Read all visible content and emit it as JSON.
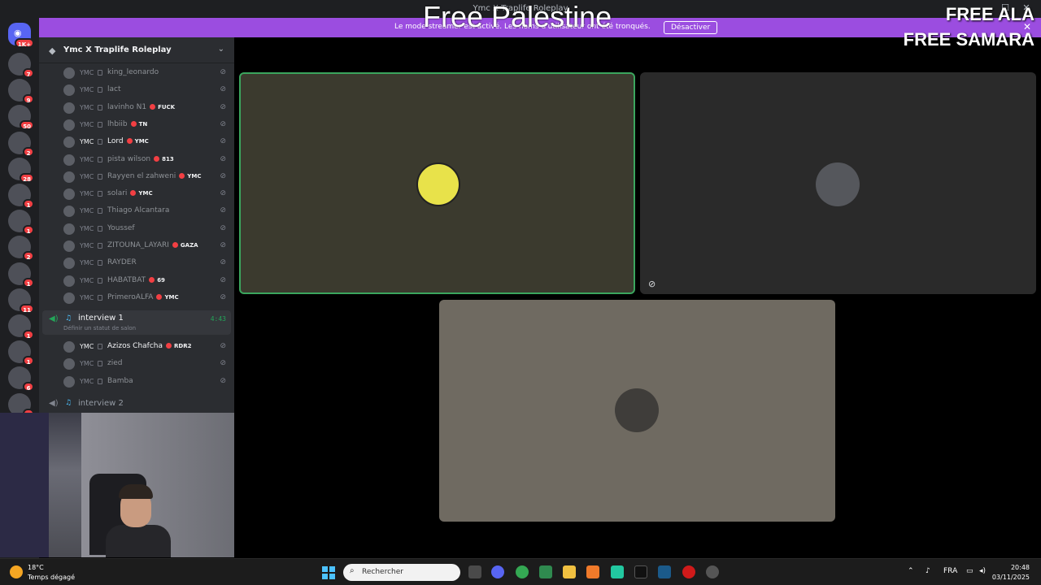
{
  "window": {
    "title": "Ymc X Traplife Roleplay"
  },
  "overlay": {
    "title": "Free Palestine",
    "free_lines": [
      "FREE ALA",
      "FREE SAMARA"
    ]
  },
  "banner": {
    "text": "Le mode streamer est activé. Les noms d'utilisateur ont été tronqués.",
    "button": "Désactiver"
  },
  "rail": {
    "home_badge": "1K+",
    "items": [
      {
        "badge": "7"
      },
      {
        "badge": "9"
      },
      {
        "badge": "50"
      },
      {
        "badge": "2"
      },
      {
        "badge": "28"
      },
      {
        "badge": "1"
      },
      {
        "badge": "1"
      },
      {
        "badge": "2"
      },
      {
        "badge": "1"
      },
      {
        "badge": "11"
      },
      {
        "badge": "1"
      },
      {
        "badge": "1"
      },
      {
        "badge": "6"
      },
      {
        "badge": "7"
      }
    ]
  },
  "server": {
    "name": "Ymc X Traplife Roleplay"
  },
  "members": [
    {
      "tag": "YMC",
      "name": "king_leonardo",
      "role": ""
    },
    {
      "tag": "YMC",
      "name": "lact",
      "role": ""
    },
    {
      "tag": "YMC",
      "name": "lavinho N1",
      "role": "FUCK"
    },
    {
      "tag": "YMC",
      "name": "lhbiib",
      "role": "TN"
    },
    {
      "tag": "YMC",
      "name": "Lord",
      "role": "YMC"
    },
    {
      "tag": "YMC",
      "name": "pista wilson",
      "role": "813"
    },
    {
      "tag": "YMC",
      "name": "Rayyen el zahweni",
      "role": "YMC"
    },
    {
      "tag": "YMC",
      "name": "solari",
      "role": "YMC"
    },
    {
      "tag": "YMC",
      "name": "Thiago Alcantara",
      "role": ""
    },
    {
      "tag": "YMC",
      "name": "Youssef",
      "role": ""
    },
    {
      "tag": "YMC",
      "name": "ZITOUNA_LAYARI",
      "role": "GAZA"
    },
    {
      "tag": "YMC",
      "name": "RAYDER",
      "role": ""
    },
    {
      "tag": "YMC",
      "name": "HABATBAT",
      "role": "69"
    },
    {
      "tag": "YMC",
      "name": "PrimeroALFA",
      "role": "YMC"
    }
  ],
  "voice_channel": {
    "name": "interview 1",
    "status": "Définir un statut de salon",
    "time": "4:43"
  },
  "voice_members": [
    {
      "tag": "YMC",
      "name": "Azizos Chafcha",
      "role": "RDR2"
    },
    {
      "tag": "YMC",
      "name": "zied",
      "role": ""
    },
    {
      "tag": "YMC",
      "name": "Bamba",
      "role": ""
    }
  ],
  "voice_channel_2": {
    "name": "interview 2"
  },
  "colors": {
    "accent": "#9b4de0",
    "speaking": "#23a559"
  },
  "taskbar": {
    "weather_temp": "18°C",
    "weather_desc": "Temps dégagé",
    "search_placeholder": "Rechercher",
    "lang": "FRA",
    "time": "20:48",
    "date": "03/11/2025"
  }
}
